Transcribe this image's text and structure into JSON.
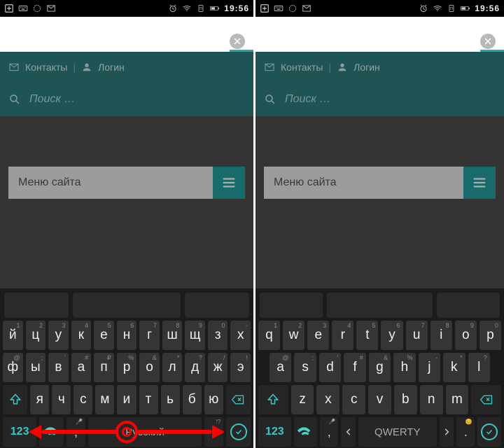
{
  "status": {
    "clock": "19:56"
  },
  "urlbar": {
    "close": "×"
  },
  "nav": {
    "contacts": "Контакты",
    "login": "Логин",
    "sep": "|"
  },
  "search": {
    "placeholder": "Поиск …"
  },
  "menu": {
    "label": "Меню сайта"
  },
  "kb_ru": {
    "row1": [
      {
        "l": "й",
        "s": "1"
      },
      {
        "l": "ц",
        "s": "2"
      },
      {
        "l": "у",
        "s": "3"
      },
      {
        "l": "к",
        "s": "4"
      },
      {
        "l": "е",
        "s": "5"
      },
      {
        "l": "н",
        "s": "6"
      },
      {
        "l": "г",
        "s": "7"
      },
      {
        "l": "ш",
        "s": "8"
      },
      {
        "l": "щ",
        "s": "9"
      },
      {
        "l": "з",
        "s": "0"
      },
      {
        "l": "х",
        "s": "-"
      }
    ],
    "row2": [
      {
        "l": "ф",
        "s": "@"
      },
      {
        "l": "ы",
        "s": ";"
      },
      {
        "l": "в",
        "s": "'"
      },
      {
        "l": "а",
        "s": "#"
      },
      {
        "l": "п",
        "s": "₽"
      },
      {
        "l": "р",
        "s": "%"
      },
      {
        "l": "о",
        "s": "&"
      },
      {
        "l": "л",
        "s": "*"
      },
      {
        "l": "д",
        "s": "?"
      },
      {
        "l": "ж",
        "s": "/"
      },
      {
        "l": "э",
        "s": "!"
      }
    ],
    "row3": [
      {
        "l": "я",
        "s": ""
      },
      {
        "l": "ч",
        "s": ""
      },
      {
        "l": "с",
        "s": ""
      },
      {
        "l": "м",
        "s": ""
      },
      {
        "l": "и",
        "s": ""
      },
      {
        "l": "т",
        "s": ""
      },
      {
        "l": "ь",
        "s": ""
      },
      {
        "l": "б",
        "s": ""
      },
      {
        "l": "ю",
        "s": ""
      }
    ],
    "space": "Русский",
    "num": "123",
    "comma": ",",
    "dot": ".",
    "comma_sub": "🎤",
    "dot_sub": "!?"
  },
  "kb_en": {
    "row1": [
      {
        "l": "q",
        "s": "1"
      },
      {
        "l": "w",
        "s": "2"
      },
      {
        "l": "e",
        "s": "3"
      },
      {
        "l": "r",
        "s": "4"
      },
      {
        "l": "t",
        "s": "5"
      },
      {
        "l": "y",
        "s": "6"
      },
      {
        "l": "u",
        "s": "7"
      },
      {
        "l": "i",
        "s": "8"
      },
      {
        "l": "o",
        "s": "9"
      },
      {
        "l": "p",
        "s": "0"
      }
    ],
    "row2": [
      {
        "l": "a",
        "s": "@"
      },
      {
        "l": "s",
        "s": ";"
      },
      {
        "l": "d",
        "s": "'"
      },
      {
        "l": "f",
        "s": "#"
      },
      {
        "l": "g",
        "s": "&"
      },
      {
        "l": "h",
        "s": "%"
      },
      {
        "l": "j",
        "s": "-"
      },
      {
        "l": "k",
        "s": "*"
      },
      {
        "l": "l",
        "s": "?"
      }
    ],
    "row3": [
      {
        "l": "z",
        "s": ""
      },
      {
        "l": "x",
        "s": ""
      },
      {
        "l": "c",
        "s": ""
      },
      {
        "l": "v",
        "s": ""
      },
      {
        "l": "b",
        "s": ""
      },
      {
        "l": "n",
        "s": ""
      },
      {
        "l": "m",
        "s": ""
      }
    ],
    "space": "QWERTY",
    "num": "123",
    "comma": ",",
    "dot": ".",
    "comma_sub": "🎤",
    "dot_sub": "😊"
  }
}
